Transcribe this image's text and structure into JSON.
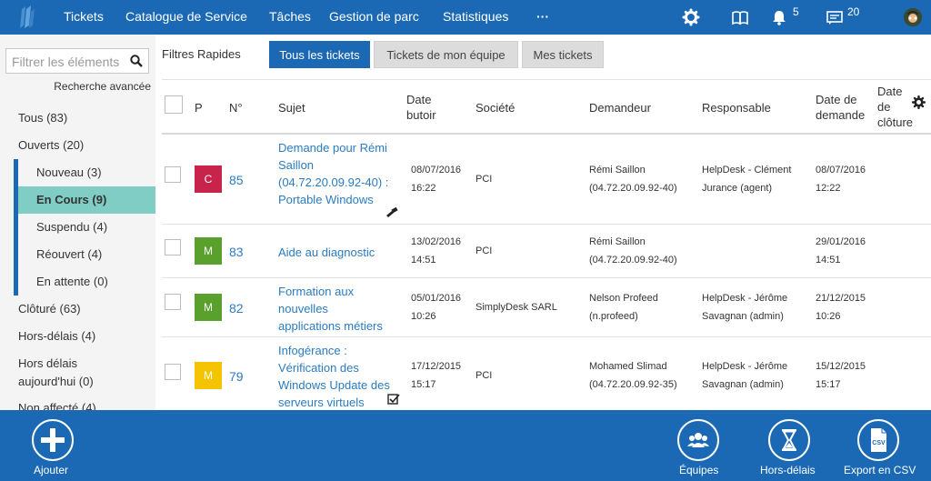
{
  "nav": {
    "items": [
      "Tickets",
      "Catalogue de Service",
      "Tâches",
      "Gestion de parc",
      "Statistiques",
      "···"
    ],
    "notifications_count": "5",
    "messages_count": "20"
  },
  "sidebar": {
    "filter_placeholder": "Filtrer les éléments",
    "advanced_search": "Recherche avancée",
    "items": [
      {
        "label": "Tous (83)"
      },
      {
        "label": "Ouverts (20)"
      },
      {
        "label": "Nouveau (3)"
      },
      {
        "label": "En Cours (9)"
      },
      {
        "label": "Suspendu (4)"
      },
      {
        "label": "Réouvert (4)"
      },
      {
        "label": "En attente (0)"
      },
      {
        "label": "Clôturé (63)"
      },
      {
        "label": "Hors-délais (4)"
      },
      {
        "label": "Hors délais"
      },
      {
        "label": "aujourd'hui (0)"
      },
      {
        "label": "Non affecté (4)"
      }
    ]
  },
  "quick_filters": {
    "label": "Filtres Rapides",
    "buttons": [
      "Tous les tickets",
      "Tickets de mon équipe",
      "Mes tickets"
    ],
    "active": "Tous les tickets"
  },
  "table": {
    "headers": {
      "p": "P",
      "num": "N°",
      "subject": "Sujet",
      "due1": "Date",
      "due2": "butoir",
      "company": "Société",
      "requester": "Demandeur",
      "assignee": "Responsable",
      "req1": "Date de",
      "req2": "demande",
      "close1": "Date",
      "close2": "de",
      "close3": "clôture"
    },
    "rows": [
      {
        "priority": "C",
        "priority_color": "#c8234a",
        "number": "85",
        "subject_lines": [
          "Demande pour Rémi",
          "Saillon",
          "(04.72.20.09.92-40) :",
          "Portable Windows"
        ],
        "due_date": "08/07/2016",
        "due_time": "16:22",
        "company": "PCI",
        "requester_name": "Rémi Saillon",
        "requester_id": "(04.72.20.09.92-40)",
        "assignee_name": "HelpDesk - Clément",
        "assignee_role": "Jurance (agent)",
        "request_date": "08/07/2016",
        "request_time": "12:22",
        "status_icon": "hammer-icon"
      },
      {
        "priority": "M",
        "priority_color": "#5aa02c",
        "number": "83",
        "subject_lines": [
          "Aide au diagnostic"
        ],
        "due_date": "13/02/2016",
        "due_time": "14:51",
        "company": "PCI",
        "requester_name": "Rémi Saillon",
        "requester_id": "(04.72.20.09.92-40)",
        "assignee_name": "",
        "assignee_role": "",
        "request_date": "29/01/2016",
        "request_time": "14:51"
      },
      {
        "priority": "M",
        "priority_color": "#5aa02c",
        "number": "82",
        "subject_lines": [
          "Formation aux",
          "nouvelles",
          "applications métiers"
        ],
        "due_date": "05/01/2016",
        "due_time": "10:26",
        "company": "SimplyDesk SARL",
        "requester_name": "Nelson Profeed",
        "requester_id": "(n.profeed)",
        "assignee_name": "HelpDesk - Jérôme",
        "assignee_role": "Savagnan (admin)",
        "request_date": "21/12/2015",
        "request_time": "10:26"
      },
      {
        "priority": "M",
        "priority_color": "#f5c400",
        "number": "79",
        "subject_lines": [
          "Infogérance :",
          "Vérification des",
          "Windows Update des",
          "serveurs virtuels"
        ],
        "due_date": "17/12/2015",
        "due_time": "15:17",
        "company": "PCI",
        "requester_name": "Mohamed Slimad",
        "requester_id": "(04.72.20.09.92-35)",
        "assignee_name": "HelpDesk - Jérôme",
        "assignee_role": "Savagnan (admin)",
        "request_date": "15/12/2015",
        "request_time": "15:17",
        "status_icon": "checkbox-icon"
      }
    ]
  },
  "bottom": {
    "add_label": "Ajouter",
    "teams_label": "Équipes",
    "overdue_label": "Hors-délais",
    "export_label": "Export en CSV",
    "csv_icon_text": "CSV"
  },
  "colors": {
    "brand": "#1b69b4",
    "active_sidebar": "#7fcdc4",
    "link": "#2b7bc0"
  }
}
